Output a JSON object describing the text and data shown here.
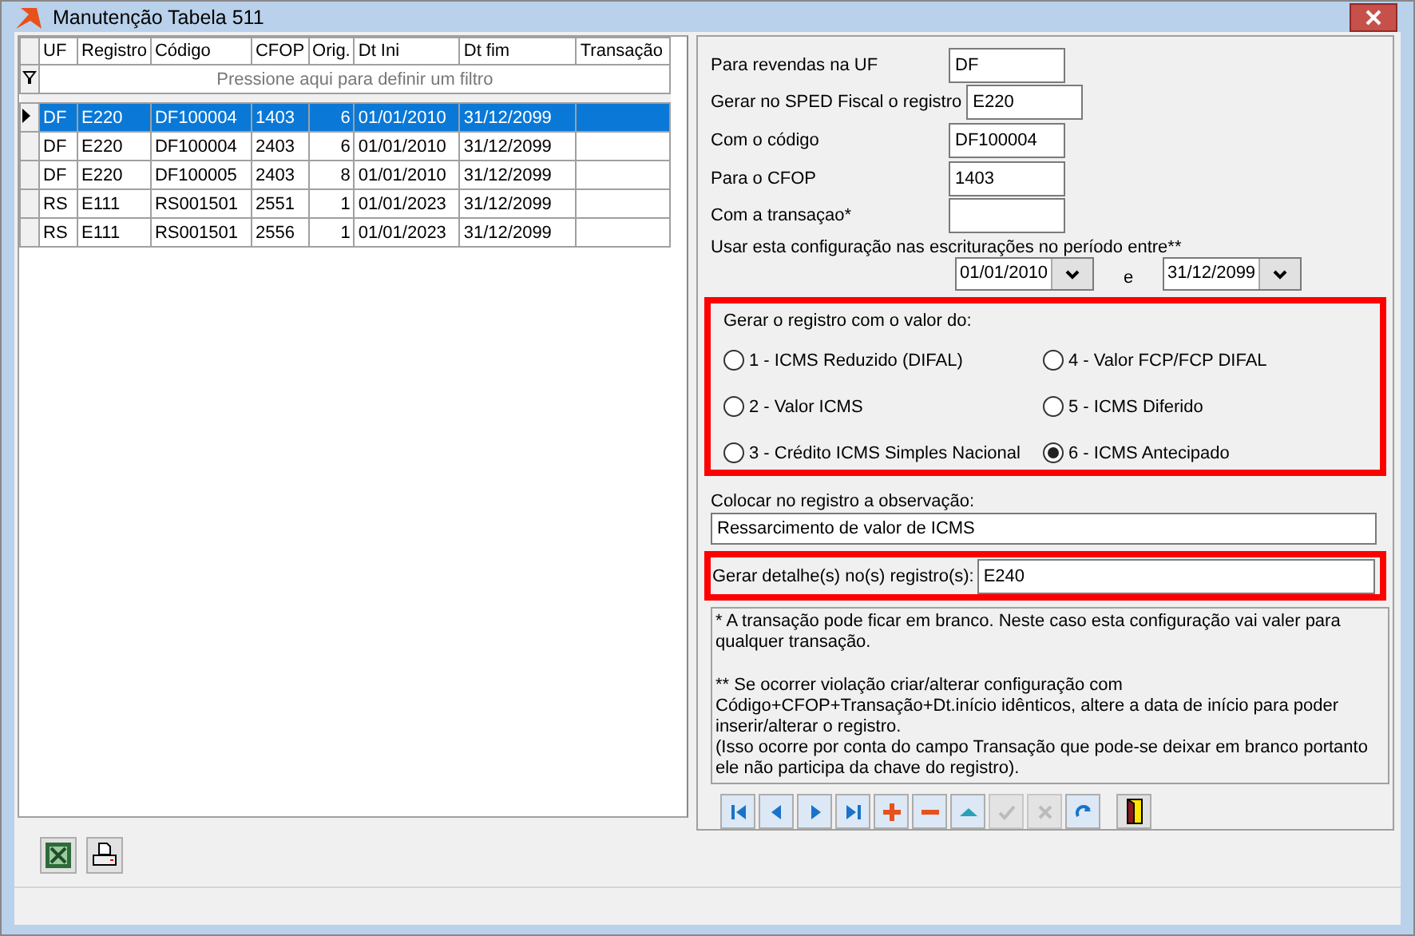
{
  "window": {
    "title": "Manutenção Tabela 511"
  },
  "grid": {
    "filter_hint": "Pressione aqui para definir um filtro",
    "columns": [
      "UF",
      "Registro",
      "Código",
      "CFOP",
      "Orig.",
      "Dt Ini",
      "Dt fim",
      "Transação"
    ],
    "rows": [
      {
        "selected": true,
        "cells": [
          "DF",
          "E220",
          "DF100004",
          "1403",
          "6",
          "01/01/2010",
          "31/12/2099"
        ]
      },
      {
        "selected": false,
        "cells": [
          "DF",
          "E220",
          "DF100004",
          "2403",
          "6",
          "01/01/2010",
          "31/12/2099"
        ]
      },
      {
        "selected": false,
        "cells": [
          "DF",
          "E220",
          "DF100005",
          "2403",
          "8",
          "01/01/2010",
          "31/12/2099"
        ]
      },
      {
        "selected": false,
        "cells": [
          "RS",
          "E111",
          "RS001501",
          "2551",
          "1",
          "01/01/2023",
          "31/12/2099"
        ]
      },
      {
        "selected": false,
        "cells": [
          "RS",
          "E111",
          "RS001501",
          "2556",
          "1",
          "01/01/2023",
          "31/12/2099"
        ]
      }
    ]
  },
  "left_buttons": [
    {
      "kind": "excel"
    },
    {
      "kind": "print"
    }
  ],
  "form": {
    "fields": [
      {
        "label": "Para revendas na UF",
        "value": "DF"
      },
      {
        "label": "Gerar no SPED Fiscal o registro",
        "value": "E220"
      },
      {
        "label": "Com o código",
        "value": "DF100004"
      },
      {
        "label": "Para o CFOP",
        "value": "1403"
      },
      {
        "label": "Com a transaçao*"
      }
    ],
    "period": {
      "label": "Usar esta configuração nas escriturações no período entre**",
      "start": "01/01/2010",
      "separator": "e",
      "end": "31/12/2099"
    },
    "value_group": {
      "title": "Gerar o registro com o valor do:",
      "highlighted": true,
      "options": [
        {
          "label": "1 - ICMS Reduzido (DIFAL)",
          "selected": false
        },
        {
          "label": "2 - Valor ICMS",
          "selected": false
        },
        {
          "label": "3 - Crédito ICMS Simples Nacional",
          "selected": false
        },
        {
          "label": "4 - Valor FCP/FCP DIFAL",
          "selected": false
        },
        {
          "label": "5 - ICMS Diferido",
          "selected": false
        },
        {
          "label": "6 - ICMS Antecipado",
          "selected": true
        }
      ]
    },
    "observation": {
      "label": "Colocar no registro a observação:",
      "value": "Ressarcimento de valor de ICMS"
    },
    "detail": {
      "label": "Gerar detalhe(s) no(s) registro(s):",
      "value": "E240",
      "highlighted": true
    },
    "notes": [
      "* A transação pode ficar em branco. Neste caso esta configuração vai valer para qualquer transação.",
      "** Se ocorrer violação criar/alterar configuração com Código+CFOP+Transação+Dt.início idênticos, altere a data de início para poder inserir/alterar o registro.\n(Isso ocorre por conta do campo Transação que pode-se deixar em branco portanto ele não participa da chave do registro)."
    ]
  },
  "navigator": [
    {
      "kind": "first",
      "disabled": false
    },
    {
      "kind": "prior",
      "disabled": false
    },
    {
      "kind": "next",
      "disabled": false
    },
    {
      "kind": "last",
      "disabled": false
    },
    {
      "kind": "insert",
      "disabled": false
    },
    {
      "kind": "delete",
      "disabled": false
    },
    {
      "kind": "edit",
      "disabled": false
    },
    {
      "kind": "post",
      "disabled": true
    },
    {
      "kind": "cancel",
      "disabled": true
    },
    {
      "kind": "refresh",
      "disabled": false
    },
    {
      "kind": "exit",
      "disabled": false
    }
  ]
}
